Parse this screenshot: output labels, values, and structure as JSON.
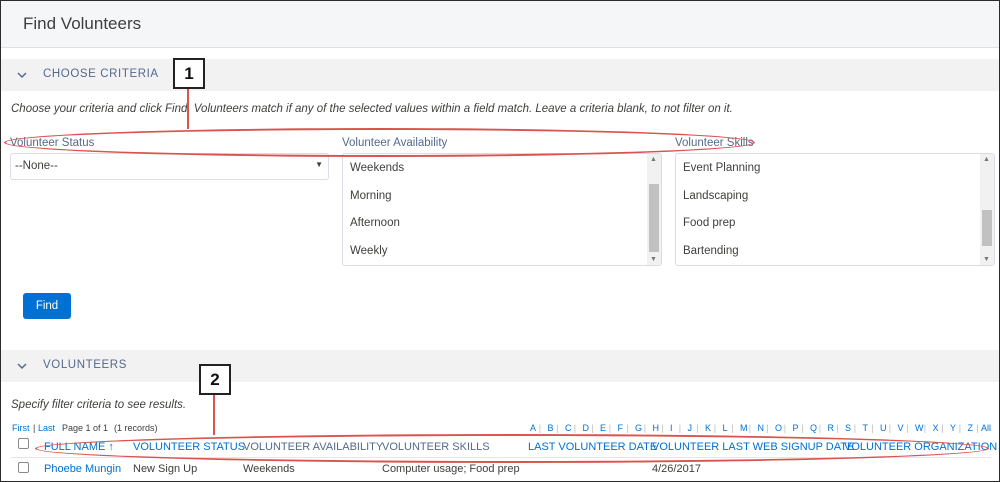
{
  "page": {
    "title": "Find Volunteers"
  },
  "criteria": {
    "section_title": "CHOOSE CRITERIA",
    "instructions": "Choose your criteria and click Find. Volunteers match if any of the selected values within a field match. Leave a criteria blank, to not filter on it.",
    "status": {
      "label": "Volunteer Status",
      "selected": "--None--"
    },
    "availability": {
      "label": "Volunteer Availability",
      "options": [
        "Weekends",
        "Morning",
        "Afternoon",
        "Weekly"
      ]
    },
    "skills": {
      "label": "Volunteer Skills",
      "options": [
        "Event Planning",
        "Landscaping",
        "Food prep",
        "Bartending"
      ]
    },
    "find_label": "Find"
  },
  "results": {
    "section_title": "VOLUNTEERS",
    "instructions": "Specify filter criteria to see results.",
    "nav": {
      "first": "First",
      "sep": "|",
      "last": "Last",
      "page_info": "Page 1 of 1",
      "records": "(1 records)"
    },
    "alphabet": [
      "A",
      "B",
      "C",
      "D",
      "E",
      "F",
      "G",
      "H",
      "I",
      "J",
      "K",
      "L",
      "M",
      "N",
      "O",
      "P",
      "Q",
      "R",
      "S",
      "T",
      "U",
      "V",
      "W",
      "X",
      "Y",
      "Z",
      "All"
    ],
    "columns": {
      "full_name": "FULL NAME ↑",
      "status": "VOLUNTEER STATUS",
      "availability": "VOLUNTEER AVAILABILITY",
      "skills": "VOLUNTEER SKILLS",
      "last_date": "LAST VOLUNTEER DATE",
      "last_signup": "VOLUNTEER LAST WEB SIGNUP DATE",
      "organization": "VOLUNTEER ORGANIZATION"
    },
    "rows": [
      {
        "full_name": "Phoebe Mungin",
        "status": "New Sign Up",
        "availability": "Weekends",
        "skills": "Computer usage; Food prep",
        "last_date": "",
        "last_signup": "4/26/2017",
        "organization": ""
      }
    ]
  },
  "callouts": {
    "one": "1",
    "two": "2"
  },
  "colors": {
    "callout": "#d9534f",
    "link": "#0070d2",
    "button": "#0070d2"
  }
}
